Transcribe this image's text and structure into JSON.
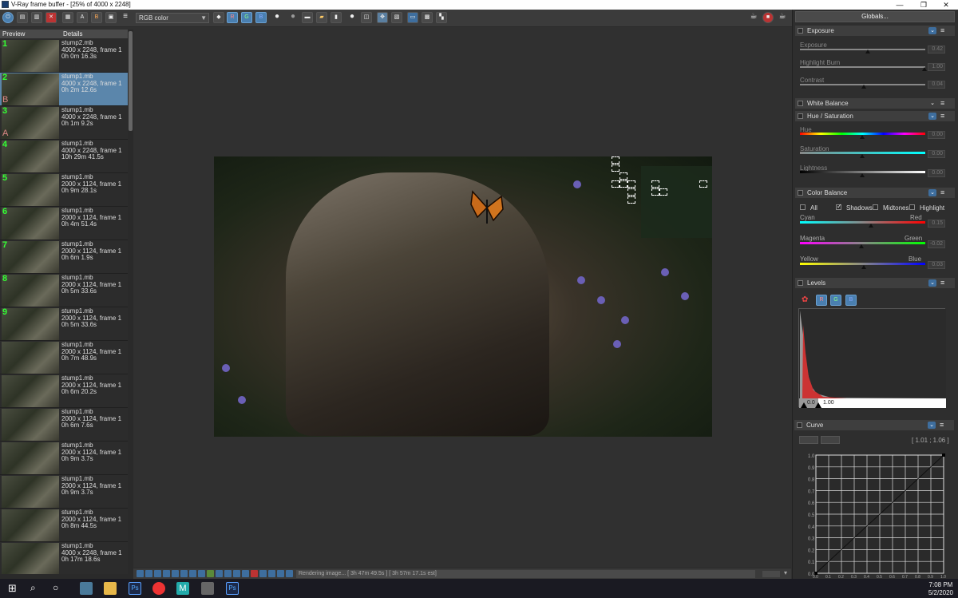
{
  "window": {
    "title": "V-Ray frame buffer - [25% of 4000 x 2248]",
    "minimize": "—",
    "maximize": "❐",
    "close": "✕"
  },
  "toolbar": {
    "channel_select": "RGB color",
    "r_label": "R",
    "g_label": "G",
    "b_label": "B"
  },
  "history": {
    "col_preview": "Preview",
    "col_details": "Details",
    "items": [
      {
        "num": "1",
        "name": "stump2.mb",
        "res": "4000 x 2248, frame 1",
        "time": "0h 0m 16.3s",
        "selected": false,
        "ab": ""
      },
      {
        "num": "2",
        "name": "stump1.mb",
        "res": "4000 x 2248, frame 1",
        "time": "0h 2m 12.6s",
        "selected": true,
        "ab": "B"
      },
      {
        "num": "3",
        "name": "stump1.mb",
        "res": "4000 x 2248, frame 1",
        "time": "0h 1m 9.2s",
        "selected": false,
        "ab": "A"
      },
      {
        "num": "4",
        "name": "stump1.mb",
        "res": "4000 x 2248, frame 1",
        "time": "10h 29m 41.5s",
        "selected": false,
        "ab": ""
      },
      {
        "num": "5",
        "name": "stump1.mb",
        "res": "2000 x 1124, frame 1",
        "time": "0h 9m 28.1s",
        "selected": false,
        "ab": ""
      },
      {
        "num": "6",
        "name": "stump1.mb",
        "res": "2000 x 1124, frame 1",
        "time": "0h 4m 51.4s",
        "selected": false,
        "ab": ""
      },
      {
        "num": "7",
        "name": "stump1.mb",
        "res": "2000 x 1124, frame 1",
        "time": "0h 6m 1.9s",
        "selected": false,
        "ab": ""
      },
      {
        "num": "8",
        "name": "stump1.mb",
        "res": "2000 x 1124, frame 1",
        "time": "0h 5m 33.6s",
        "selected": false,
        "ab": ""
      },
      {
        "num": "9",
        "name": "stump1.mb",
        "res": "2000 x 1124, frame 1",
        "time": "0h 5m 33.6s",
        "selected": false,
        "ab": ""
      },
      {
        "num": "",
        "name": "stump1.mb",
        "res": "2000 x 1124, frame 1",
        "time": "0h 7m 48.9s",
        "selected": false,
        "ab": ""
      },
      {
        "num": "",
        "name": "stump1.mb",
        "res": "2000 x 1124, frame 1",
        "time": "0h 6m 20.2s",
        "selected": false,
        "ab": ""
      },
      {
        "num": "",
        "name": "stump1.mb",
        "res": "2000 x 1124, frame 1",
        "time": "0h 6m 7.6s",
        "selected": false,
        "ab": ""
      },
      {
        "num": "",
        "name": "stump1.mb",
        "res": "2000 x 1124, frame 1",
        "time": "0h 9m 3.7s",
        "selected": false,
        "ab": ""
      },
      {
        "num": "",
        "name": "stump1.mb",
        "res": "2000 x 1124, frame 1",
        "time": "0h 9m 3.7s",
        "selected": false,
        "ab": ""
      },
      {
        "num": "",
        "name": "stump1.mb",
        "res": "2000 x 1124, frame 1",
        "time": "0h 8m 44.5s",
        "selected": false,
        "ab": ""
      },
      {
        "num": "",
        "name": "stump1.mb",
        "res": "4000 x 2248, frame 1",
        "time": "0h 17m 18.6s",
        "selected": false,
        "ab": ""
      }
    ]
  },
  "status": {
    "text": "Rendering image... [ 3h 47m 49.5s ] [ 3h 57m 17.1s est]"
  },
  "panel": {
    "globals": "Globals...",
    "exposure": {
      "title": "Exposure",
      "exposure_label": "Exposure",
      "exposure_val": "0.42",
      "burn_label": "Highlight Burn",
      "burn_val": "1.00",
      "contrast_label": "Contrast",
      "contrast_val": "0.04"
    },
    "white_balance": {
      "title": "White Balance"
    },
    "hue_sat": {
      "title": "Hue / Saturation",
      "hue_label": "Hue",
      "hue_val": "0.00",
      "sat_label": "Saturation",
      "sat_val": "0.00",
      "light_label": "Lightness",
      "light_val": "0.00"
    },
    "color_balance": {
      "title": "Color Balance",
      "all": "All",
      "shadows": "Shadows",
      "midtones": "Midtones",
      "highlight": "Highlight",
      "cyan": "Cyan",
      "red": "Red",
      "cr_val": "0.15",
      "magenta": "Magenta",
      "green": "Green",
      "mg_val": "-0.02",
      "yellow": "Yellow",
      "blue": "Blue",
      "yb_val": "0.03"
    },
    "levels": {
      "title": "Levels",
      "low": "0.0",
      "high": "1.00"
    },
    "curve": {
      "title": "Curve",
      "coord": "[ 1.01 ; 1.06 ]",
      "ylabels": [
        "1.0",
        "0.9",
        "0.8",
        "0.7",
        "0.6",
        "0.5",
        "0.4",
        "0.3",
        "0.2",
        "0.1",
        "0.0"
      ],
      "xlabels": [
        "0.0",
        "0.1",
        "0.2",
        "0.3",
        "0.4",
        "0.5",
        "0.6",
        "0.7",
        "0.8",
        "0.9",
        "1.0"
      ]
    }
  },
  "taskbar": {
    "time": "7:08 PM",
    "date": "5/2/2020"
  }
}
